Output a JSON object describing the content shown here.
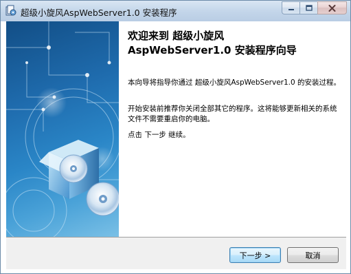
{
  "window": {
    "title": "超级小旋风AspWebServer1.0 安装程序"
  },
  "content": {
    "heading_line1": "欢迎来到 超级小旋风",
    "heading_line2": "AspWebServer1.0 安装程序向导",
    "para1": "本向导将指导你通过 超级小旋风AspWebServer1.0 的安装过程。",
    "para2": "开始安装前推荐你关闭全部其它的程序。这将能够更新相关的系统文件不需要重启你的电脑。",
    "para3": "点击 下一步 继续。"
  },
  "buttons": {
    "next_label": "下一步 >",
    "cancel_label": "取消"
  },
  "colors": {
    "titlebar": "#c4d6ea",
    "banner_dark": "#124e86",
    "banner_light": "#7ac0e6",
    "footer": "#f0f0f0",
    "default_button_border": "#3c7fb1"
  },
  "icons": {
    "app": "installer-app-icon",
    "minimize": "minimize-icon",
    "maximize": "maximize-icon",
    "close": "close-icon",
    "banner": "software-box-cd-icon"
  }
}
